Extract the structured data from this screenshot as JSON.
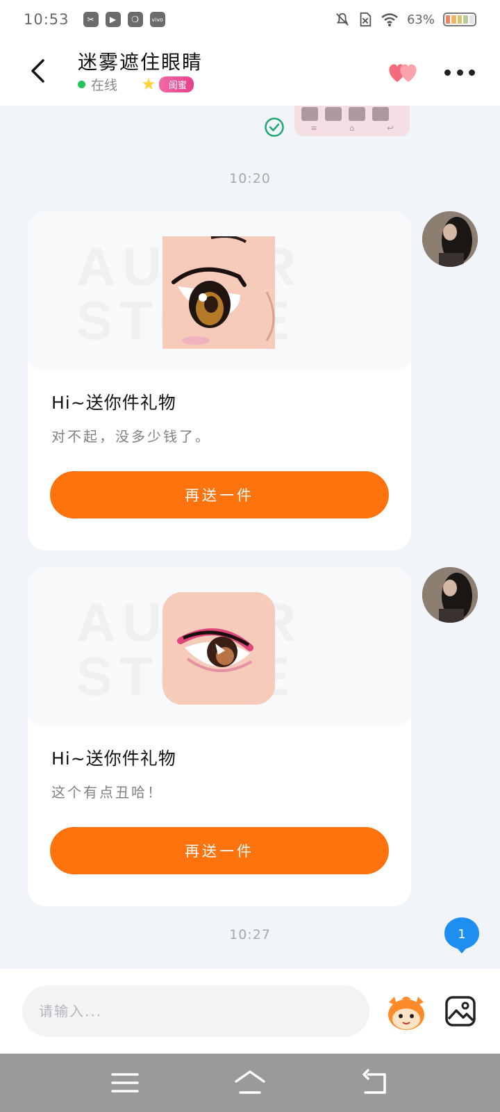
{
  "status_bar": {
    "time": "10:53",
    "battery_text": "63%",
    "icons": [
      "screenshot-icon",
      "play-icon",
      "leaf-icon",
      "vivo-icon",
      "mute-bell-icon",
      "sim-off-icon",
      "wifi-icon",
      "battery-icon"
    ]
  },
  "header": {
    "contact_name": "迷雾遮住眼睛",
    "status": "在线",
    "relation_badge": "闺蜜"
  },
  "timestamps": [
    "10:20",
    "10:27"
  ],
  "gifts": [
    {
      "title": "Hi~送你件礼物",
      "message": "对不起，没多少钱了。",
      "button": "再送一件"
    },
    {
      "title": "Hi~送你件礼物",
      "message": "这个有点丑哈！",
      "button": "再送一件"
    }
  ],
  "watermark": "AUTOR STORE",
  "unread_count": "1",
  "composer": {
    "placeholder": "请输入..."
  },
  "colors": {
    "accent": "#ff730f",
    "online": "#25c25b",
    "unread_bubble": "#1e8ff0"
  }
}
